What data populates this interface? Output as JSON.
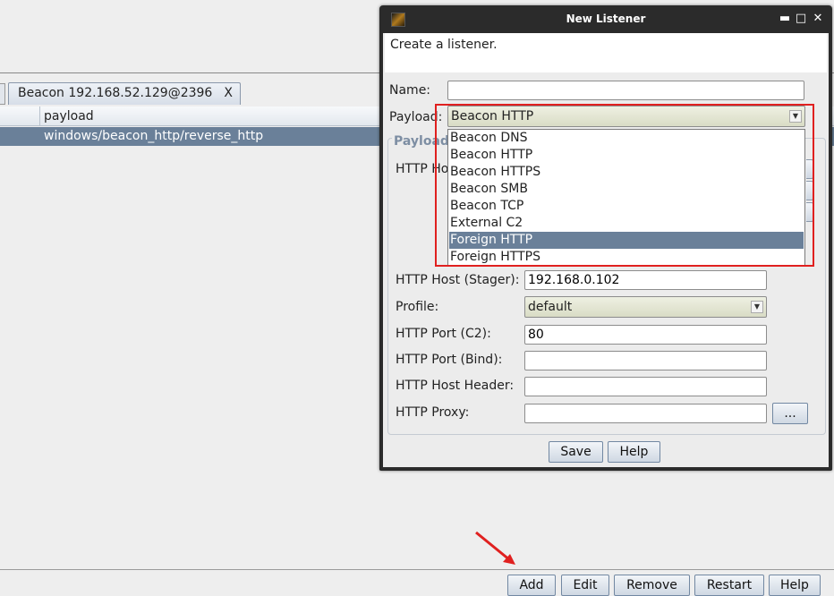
{
  "main": {
    "tab_label": "Beacon 192.168.52.129@2396",
    "tab_close": "X",
    "table": {
      "header": "payload",
      "rows": [
        "windows/beacon_http/reverse_http"
      ]
    },
    "buttons": {
      "add": "Add",
      "edit": "Edit",
      "remove": "Remove",
      "restart": "Restart",
      "help": "Help"
    }
  },
  "dialog": {
    "title": "New Listener",
    "window_buttons": {
      "minimize": "▬",
      "maximize": "□",
      "close": "✕"
    },
    "description": "Create a listener.",
    "name_label": "Name:",
    "name_value": "",
    "payload_label": "Payload:",
    "payload_value": "Beacon HTTP",
    "group_title": "Payload Options",
    "group_title_visible": "Payload",
    "hidden_label_fragment": "HTTP Ho",
    "payload_options": [
      "Beacon DNS",
      "Beacon HTTP",
      "Beacon HTTPS",
      "Beacon SMB",
      "Beacon TCP",
      "External C2",
      "Foreign HTTP",
      "Foreign HTTPS"
    ],
    "highlighted_option": "Foreign HTTP",
    "fields": {
      "stager_host_label": "HTTP Host (Stager):",
      "stager_host_value": "192.168.0.102",
      "profile_label": "Profile:",
      "profile_value": "default",
      "port_c2_label": "HTTP Port (C2):",
      "port_c2_value": "80",
      "port_bind_label": "HTTP Port (Bind):",
      "port_bind_value": "",
      "host_header_label": "HTTP Host Header:",
      "host_header_value": "",
      "proxy_label": "HTTP Proxy:",
      "proxy_value": "",
      "proxy_button": "..."
    },
    "save_button": "Save",
    "help_button": "Help"
  },
  "colors": {
    "selection": "#6a8099",
    "annotation": "#e0201f",
    "titlebar": "#2b2b2b"
  }
}
